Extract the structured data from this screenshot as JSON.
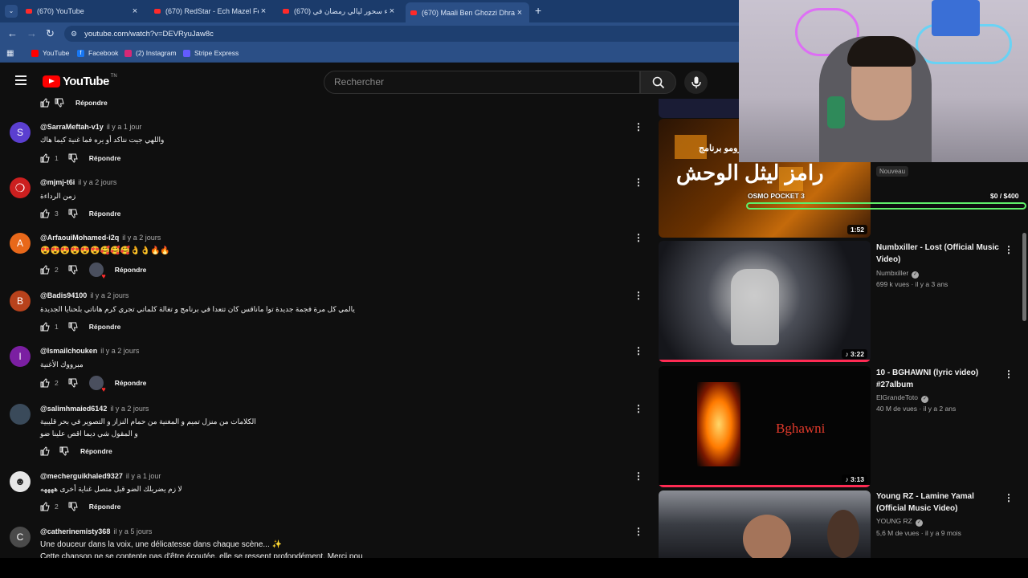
{
  "browser": {
    "tabs": [
      {
        "label": "(670) YouTube"
      },
      {
        "label": "(670) RedStar - Ech Mazel Feat"
      },
      {
        "label": "(670) أجواء سحور ليالي رمضان في"
      },
      {
        "label": "(670) Maali Ben Ghozzi Dhrab..."
      }
    ],
    "url": "youtube.com/watch?v=DEVRyuJaw8c",
    "bookmarks": [
      "YouTube",
      "Facebook",
      "(2) Instagram",
      "Stripe Express"
    ]
  },
  "header": {
    "logo_text": "YouTube",
    "logo_tm": "TN",
    "search_placeholder": "Rechercher"
  },
  "top_reply_label": "Répondre",
  "comments": [
    {
      "avatar": "S",
      "avatar_color": "#5b3fd0",
      "author": "@SarraMeftah-v1y",
      "time": "il y a 1 jour",
      "lines": [
        "واللهي جيت نتاكد أو يرە فما غنية كيما هاك"
      ],
      "likes": "1",
      "reply": "Répondre"
    },
    {
      "avatar": "",
      "avatar_color": "#cc1f1f",
      "author": "@mjmj-t6i",
      "time": "il y a 2 jours",
      "lines": [
        "زمن الرداءة"
      ],
      "likes": "3",
      "reply": "Répondre"
    },
    {
      "avatar": "A",
      "avatar_color": "#e8681a",
      "author": "@ArfaouiMohamed-i2q",
      "time": "il y a 2 jours",
      "lines": [
        "😍😍😍😍😍😍🥰🥰🥰👌👌🔥🔥"
      ],
      "likes": "2",
      "reply": "Répondre"
    },
    {
      "avatar": "B",
      "avatar_color": "#b8421c",
      "author": "@Badis94100",
      "time": "il y a 2 jours",
      "lines": [
        "يالمي كل مرة فجمة جديدة توا ماناقس كان تتعدا في برنامج و تغالة كلماتي تجري كرم هاناتي بلحنايا الجديدة"
      ],
      "likes": "1",
      "reply": "Répondre"
    },
    {
      "avatar": "I",
      "avatar_color": "#7b1fa2",
      "author": "@Ismailchouken",
      "time": "il y a 2 jours",
      "lines": [
        "مبرووك الأغنية"
      ],
      "likes": "2",
      "reply": "Répondre"
    },
    {
      "avatar": "",
      "avatar_color": "#3a4a5a",
      "author": "@salimhmaied6142",
      "time": "il y a 2 jours",
      "lines": [
        "الكلامات من منزل تميم و المغنية من حمام النزاز و التصوير في بحر قليبية",
        "و المقول شي ديما اقص علينا ضو"
      ],
      "likes": "",
      "reply": "Répondre"
    },
    {
      "avatar": "",
      "avatar_color": "#e6e6e6",
      "author": "@mecherguikhaled9327",
      "time": "il y a 1 jour",
      "lines": [
        "لا زم يضربلك الضو قبل متصل غناية أخرى ههههه"
      ],
      "likes": "2",
      "reply": "Répondre"
    },
    {
      "avatar": "C",
      "avatar_color": "#4a4a4a",
      "author": "@catherinemisty368",
      "time": "il y a 5 jours",
      "lines": [
        "Une douceur dans la voix, une délicatesse dans chaque scène... ✨",
        "Cette chanson ne se contente pas d'être écoutée, elle se ressent profondément. Merci pou"
      ],
      "likes": "",
      "reply": ""
    }
  ],
  "sidebar": {
    "promo": {
      "thumb_text": "رامز ليثل الوحش",
      "thumb_subtext": "رومو برنامج",
      "duration": "1:52",
      "badge": "Nouveau"
    },
    "videos": [
      {
        "title": "Numbxiller - Lost (Official Music Video)",
        "channel": "Numbxiller",
        "meta": "699 k vues · il y a 3 ans",
        "duration": "3:22"
      },
      {
        "title": "10 - BGHAWNI (lyric video) #27album",
        "channel": "ElGrandeToto",
        "meta": "40 M de vues · il y a 2 ans",
        "duration": "3:13",
        "thumb_text": "Bghawni"
      },
      {
        "title": "Young RZ - Lamine Yamal (Official Music Video)",
        "channel": "YOUNG RZ",
        "meta": "5,6 M de vues · il y a 9 mois",
        "duration": ""
      }
    ]
  },
  "stream_overlay": {
    "label": "OSMO POCKET 3",
    "goal": "$0  / $400",
    "progress": 0
  }
}
